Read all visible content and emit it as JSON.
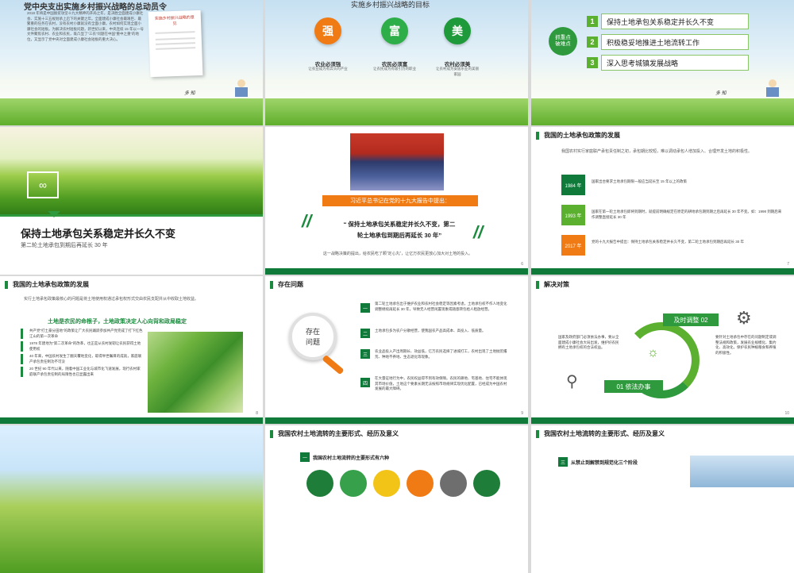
{
  "slide1": {
    "title": "党中央支出实施乡村振兴战略的总动员令",
    "body": "2018 年将是中国脱贫攻坚十九大精神的开局之年，是决胜全面建成小康社会、实施十三五规划承上启下的关键之年。全面建成小康社会最艰巨、最繁重的任务在农村，没有农村小康就没有全面小康。农村如何实现全面小康社会的短板。为解决农村短板问题，新世纪以来，中央连续 15 年以一号文件聚焦农村、农业和农民，既凸显了“三农”问题在中国“重中之重”的地位，又显示了党中央对全面建成小康社会短板的重大决心。",
    "doc_label": "实施乡村振兴战略的意见",
    "signature": "多 知"
  },
  "slide2": {
    "title": "实施乡村振兴战略的目标",
    "circles": [
      {
        "char": "强",
        "color": "#f07a14",
        "heading": "农业必须强",
        "desc": "让农业成为有奔头的产业"
      },
      {
        "char": "富",
        "color": "#2eae48",
        "heading": "农民必须富",
        "desc": "让农民成为有吸引力的职业"
      },
      {
        "char": "美",
        "color": "#1f9a3a",
        "heading": "农村必须美",
        "desc": "让农村成为安居乐业的美丽家园"
      }
    ]
  },
  "slide3": {
    "badge": "抓重点 破难点",
    "items": [
      {
        "num": "1",
        "text": "保持土地承包关系稳定并长久不变"
      },
      {
        "num": "2",
        "text": "积极稳妥地推进土地流转工作"
      },
      {
        "num": "3",
        "text": "深入思考城镇发展战略"
      }
    ]
  },
  "slide4": {
    "title": "保持土地承包关系稳定并长久不变",
    "subtitle": "第二轮土地承包到期后再延长 30 年"
  },
  "slide5": {
    "banner": "习近平总书记在党的十九大报告中提出：",
    "quote_line1": "“ 保持土地承包关系稳定并长久不变，第二",
    "quote_line2": "轮土地承包到期后再延长 30 年”",
    "bottom": "这一战略决策的提出，给农民吃了颗“定心丸”，让亿万农民更放心加大对土地的投入。",
    "page": "6"
  },
  "slide6": {
    "header": "我国的土地承包政策的发展",
    "intro": "我国农村实行家庭联产承包责任制之初，承包期比较短，难以调动承包人增加投入、合理开发土地的积极性。",
    "rows": [
      {
        "year": "1984 年",
        "color": "#0f7a3a",
        "text": "国家出台要求土地承包期限一般应当延长至 15 年以上的政策"
      },
      {
        "year": "1993 年",
        "color": "#5bb02f",
        "text": "国家在第一轮土地承包即将到期时，就提前明确规定在原定的耕地承包期到期之后再延长 30 年不变。如：1998 到期后来作调整直接延长 30 年"
      },
      {
        "year": "2017 年",
        "color": "#f07a14",
        "text": "党的十九大报告中提出：保持土地承包关系稳定并长久不变，第二轮土地承包到期后再延长 30 年"
      }
    ],
    "page": "7"
  },
  "slide7": {
    "header": "我国的土地承包政策的发展",
    "intro": "实行土地承包政策最核心的问题是将土地使用权通过承包权形式交由农民支配并从中收取土地收益。",
    "highlight": "土地是农民的命根子，土地政策决定人心向背和政局稳定",
    "bullets": [
      "共产党“打土豪分田地”的政策让广大农民踊跃参加共产党完成了打下红色江山的第一次革命",
      "1978 年建地为“第二次革命”的改革，也正是从农村发轫让农民获得土地使用权",
      "40 年来，中国农村发生了翻天覆地变化，取得举世瞩目的成就，家庭联产承包责任制功不可没",
      "20 世纪 90 年代以来，随着中国工业化与城市化飞速发展，现行农村家庭联产承包责任制的局限性也已显露出来"
    ],
    "page": "8"
  },
  "slide8": {
    "header": "存在问题",
    "glass_text_1": "存在",
    "glass_text_2": "问题",
    "items": [
      {
        "num": "一",
        "text": "第二轮土地承包出于维护农业和农村社会稳定等因素考虑，土地承包权不作人地变化调整继续再延长 30 年，导致无人经营闲置现象或随意转包给人租放经营。"
      },
      {
        "num": "二",
        "text": "土地承包多为农户分散经营，使我国农产品高成本、高投入、低质量。"
      },
      {
        "num": "三",
        "text": "农业品投入产出周期长、效益低，亿万农民选择了进城打工，农村出现了土地抛荒撂荒、种地不养地、生态退化等现象。"
      },
      {
        "num": "四",
        "text": "在大量征地行为中，农民权益得不到有效保障。农民的耕地、宅基地、住宅不能体现其市场价值，土地这个要素长期无法按照市场规律实现优化配置，已经成为中国农村发展的最大障碍。"
      }
    ],
    "page": "9"
  },
  "slide9": {
    "header": "解决对策",
    "left_text": "国家及政府部门必须依法办事，要从全面建成小康社会大局出发，维护好农民拥有土地承包权的合法权益。",
    "right_text": "要针对土地承包中存在的问题制定或调整法规和政策，发展农业规模化、集约化、高效化，保护农民种植粮食和养殖的积极性。",
    "label_01": "01 依法办事",
    "label_02": "及时调整 02",
    "page": "10"
  },
  "slide11": {
    "header": "我国农村土地流转的主要形式、经历及意义",
    "sub": "我国农村土地流转的主要形式有六种",
    "sub_num": "一",
    "circle_colors": [
      "#1f7d3a",
      "#36a04a",
      "#f3c418",
      "#f07a14",
      "#6e6e6e",
      "#1f7d3a"
    ]
  },
  "slide12": {
    "header": "我国农村土地流转的主要形式、经历及意义",
    "sub": "从禁止到解禁到规范化三个阶段",
    "sub_num": "三"
  }
}
